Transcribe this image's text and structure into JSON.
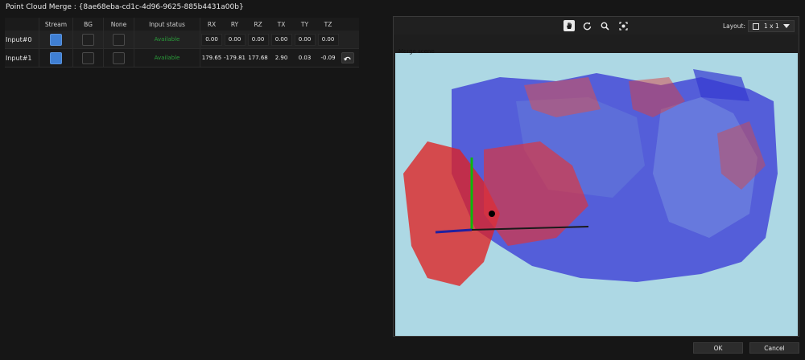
{
  "window": {
    "title": "Point Cloud Merge : {8ae68eba-cd1c-4d96-9625-885b4431a00b}"
  },
  "table": {
    "headers": {
      "stream": "Stream",
      "bg": "BG",
      "none": "None",
      "status": "Input status",
      "rx": "RX",
      "ry": "RY",
      "rz": "RZ",
      "tx": "TX",
      "ty": "TY",
      "tz": "TZ"
    },
    "rows": [
      {
        "name": "Input#0",
        "stream": true,
        "bg": false,
        "none": false,
        "status": "Available",
        "rx": "0.00",
        "ry": "0.00",
        "rz": "0.00",
        "tx": "0.00",
        "ty": "0.00",
        "tz": "0.00"
      },
      {
        "name": "Input#1",
        "stream": true,
        "bg": false,
        "none": false,
        "status": "Available",
        "rx": "179.65",
        "ry": "-179.81",
        "rz": "177.68",
        "tx": "2.90",
        "ty": "0.03",
        "tz": "-0.09"
      }
    ],
    "status_color": "#2a9c3a"
  },
  "viewer": {
    "tools": [
      "pan-hand-icon",
      "rotate-icon",
      "zoom-icon",
      "fit-view-icon"
    ],
    "layout_label": "Layout:",
    "layout_value": "1 x 1",
    "scene_label": "Merge scene",
    "background": "#add8e4",
    "cloud_colors": {
      "input0": "#e02020",
      "input1": "#2020e0"
    }
  },
  "footer": {
    "ok": "OK",
    "cancel": "Cancel"
  }
}
